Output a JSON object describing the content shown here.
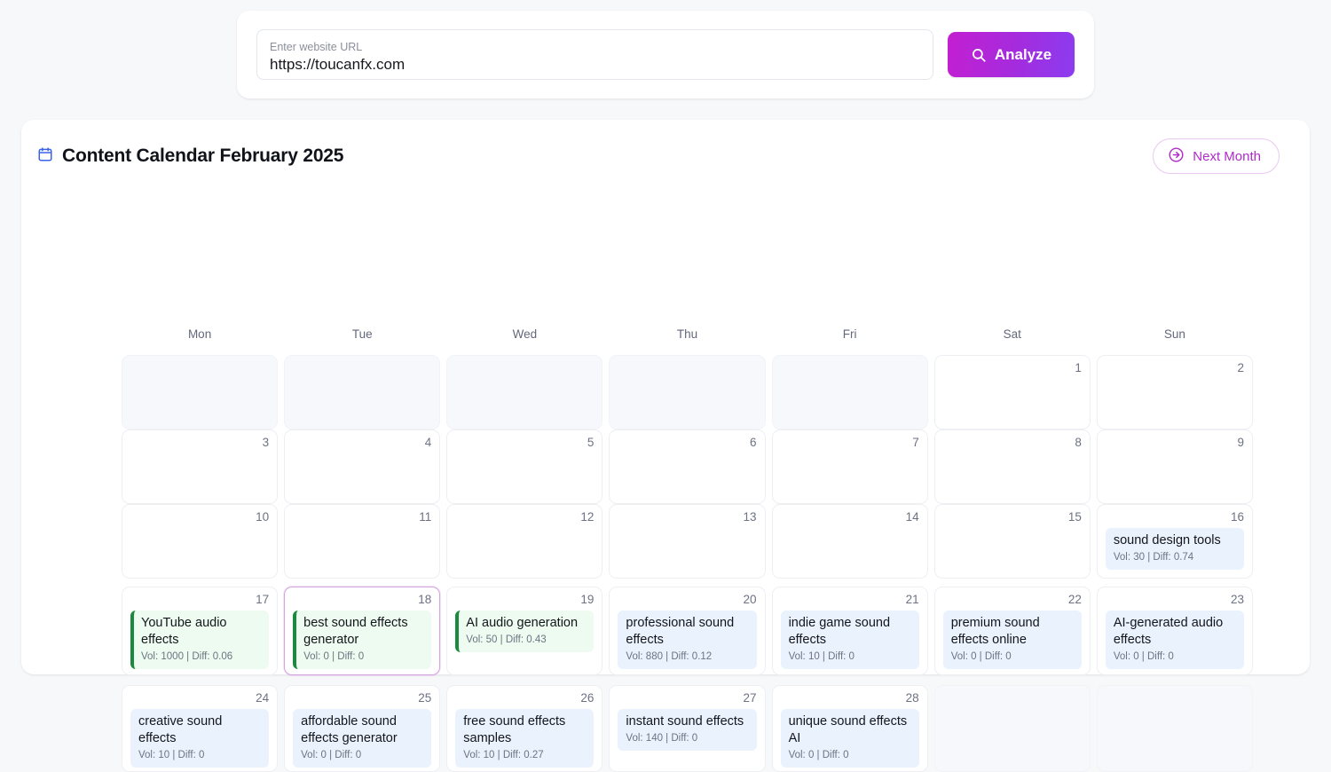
{
  "url_bar": {
    "label": "Enter website URL",
    "value": "https://toucanfx.com",
    "placeholder": "Enter website URL",
    "analyze_label": "Analyze",
    "analyze_icon": "search-icon",
    "accent_from": "#c31fd1",
    "accent_to": "#8b3cf0"
  },
  "calendar": {
    "icon": "calendar-icon",
    "icon_color": "#3b63e8",
    "title": "Content Calendar February 2025",
    "next_month_label": "Next Month",
    "next_month_icon": "arrow-right-circle-icon",
    "next_month_color": "#b02bc9",
    "weekdays": [
      "Mon",
      "Tue",
      "Wed",
      "Thu",
      "Fri",
      "Sat",
      "Sun"
    ],
    "weeks": [
      [
        {
          "blank": true
        },
        {
          "blank": true
        },
        {
          "blank": true
        },
        {
          "blank": true
        },
        {
          "blank": true
        },
        {
          "day": "1"
        },
        {
          "day": "2"
        }
      ],
      [
        {
          "day": "3"
        },
        {
          "day": "4"
        },
        {
          "day": "5"
        },
        {
          "day": "6"
        },
        {
          "day": "7"
        },
        {
          "day": "8"
        },
        {
          "day": "9"
        }
      ],
      [
        {
          "day": "10"
        },
        {
          "day": "11"
        },
        {
          "day": "12"
        },
        {
          "day": "13"
        },
        {
          "day": "14"
        },
        {
          "day": "15"
        },
        {
          "day": "16",
          "event": {
            "title": "sound design tools",
            "meta": "Vol: 30 | Diff: 0.74",
            "style": "blue"
          }
        }
      ],
      [
        {
          "day": "17",
          "event": {
            "title": "YouTube audio effects",
            "meta": "Vol: 1000 | Diff: 0.06",
            "style": "green"
          }
        },
        {
          "day": "18",
          "today": true,
          "event": {
            "title": "best sound effects generator",
            "meta": "Vol: 0 | Diff: 0",
            "style": "green"
          }
        },
        {
          "day": "19",
          "event": {
            "title": "AI audio generation",
            "meta": "Vol: 50 | Diff: 0.43",
            "style": "green"
          }
        },
        {
          "day": "20",
          "event": {
            "title": "professional sound effects",
            "meta": "Vol: 880 | Diff: 0.12",
            "style": "blue"
          }
        },
        {
          "day": "21",
          "event": {
            "title": "indie game sound effects",
            "meta": "Vol: 10 | Diff: 0",
            "style": "blue"
          }
        },
        {
          "day": "22",
          "event": {
            "title": "premium sound effects online",
            "meta": "Vol: 0 | Diff: 0",
            "style": "blue"
          }
        },
        {
          "day": "23",
          "event": {
            "title": "AI-generated audio effects",
            "meta": "Vol: 0 | Diff: 0",
            "style": "blue"
          }
        }
      ],
      [
        {
          "day": "24",
          "event": {
            "title": "creative sound effects",
            "meta": "Vol: 10 | Diff: 0",
            "style": "blue"
          }
        },
        {
          "day": "25",
          "event": {
            "title": "affordable sound effects generator",
            "meta": "Vol: 0 | Diff: 0",
            "style": "blue"
          }
        },
        {
          "day": "26",
          "event": {
            "title": "free sound effects samples",
            "meta": "Vol: 10 | Diff: 0.27",
            "style": "blue"
          }
        },
        {
          "day": "27",
          "event": {
            "title": "instant sound effects",
            "meta": "Vol: 140 | Diff: 0",
            "style": "blue"
          }
        },
        {
          "day": "28",
          "event": {
            "title": "unique sound effects AI",
            "meta": "Vol: 0 | Diff: 0",
            "style": "blue"
          }
        },
        {
          "blank": true
        },
        {
          "blank": true
        }
      ]
    ]
  }
}
